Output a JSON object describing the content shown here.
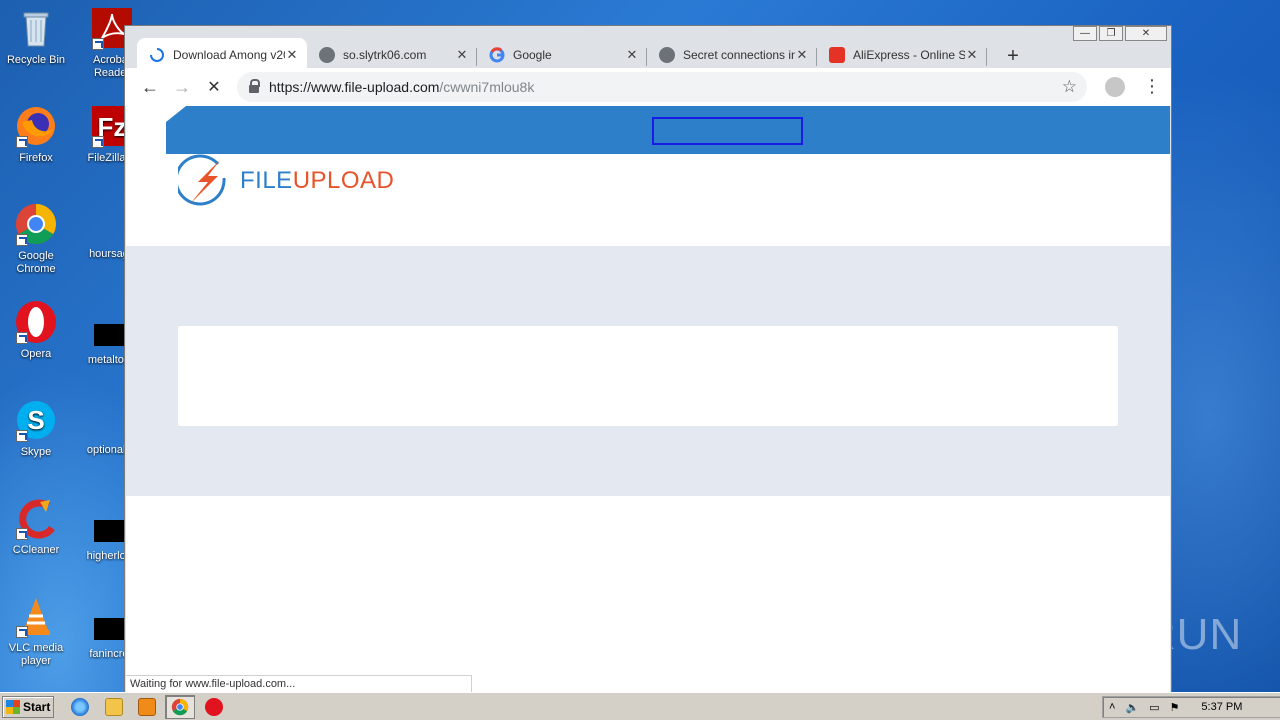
{
  "desktop": {
    "icons_left": [
      {
        "label": "Recycle Bin",
        "icon": "recycle-bin-icon"
      },
      {
        "label": "Firefox",
        "icon": "firefox-icon"
      },
      {
        "label": "Google Chrome",
        "icon": "chrome-icon"
      },
      {
        "label": "Opera",
        "icon": "opera-icon"
      },
      {
        "label": "Skype",
        "icon": "skype-icon"
      },
      {
        "label": "CCleaner",
        "icon": "ccleaner-icon"
      },
      {
        "label": "VLC media player",
        "icon": "vlc-icon"
      }
    ],
    "icons_right": [
      {
        "label": "Acrobat Reader",
        "icon": "acrobat-icon"
      },
      {
        "label": "FileZilla C",
        "icon": "filezilla-icon"
      },
      {
        "label": "hoursage",
        "icon": "blank-file-icon"
      },
      {
        "label": "metaltoda",
        "icon": "black-thumbnail-icon"
      },
      {
        "label": "optionalch",
        "icon": "blank-file-icon"
      },
      {
        "label": "higherlove",
        "icon": "black-thumbnail-icon"
      },
      {
        "label": "fanincrea",
        "icon": "black-thumbnail-icon"
      }
    ],
    "watermark": "ANY RUN"
  },
  "browser": {
    "window_controls": {
      "minimize": "—",
      "restore": "❐",
      "close": "✕"
    },
    "tabs": [
      {
        "title": "Download Among v20...",
        "favicon": "loading-spinner-icon",
        "close": "✕",
        "active": true
      },
      {
        "title": "so.slytrk06.com",
        "favicon": "globe-icon",
        "close": "✕",
        "active": false
      },
      {
        "title": "Google",
        "favicon": "google-icon",
        "close": "✕",
        "active": false
      },
      {
        "title": "Secret connections in...",
        "favicon": "globe-icon",
        "close": "✕",
        "active": false
      },
      {
        "title": "AliExpress - Online Sh...",
        "favicon": "aliexpress-icon",
        "close": "✕",
        "active": false
      }
    ],
    "new_tab": "+",
    "nav": {
      "back": "←",
      "forward": "→",
      "stop": "✕"
    },
    "url_base": "https://www.file-upload.com",
    "url_path": "/cwwni7mlou8k",
    "bookmark": "☆",
    "menu": "⋮",
    "status": "Waiting for www.file-upload.com...",
    "page": {
      "logo_text_a": "FILE",
      "logo_text_b": "UPLOAD",
      "colors": {
        "brand_blue": "#2e7fca",
        "brand_orange": "#e8542a",
        "band_grey": "#e4e8f0"
      }
    }
  },
  "taskbar": {
    "start": "Start",
    "apps": [
      "ie-icon",
      "explorer-icon",
      "media-player-icon",
      "chrome-icon",
      "opera-icon"
    ],
    "time": "5:37 PM"
  }
}
